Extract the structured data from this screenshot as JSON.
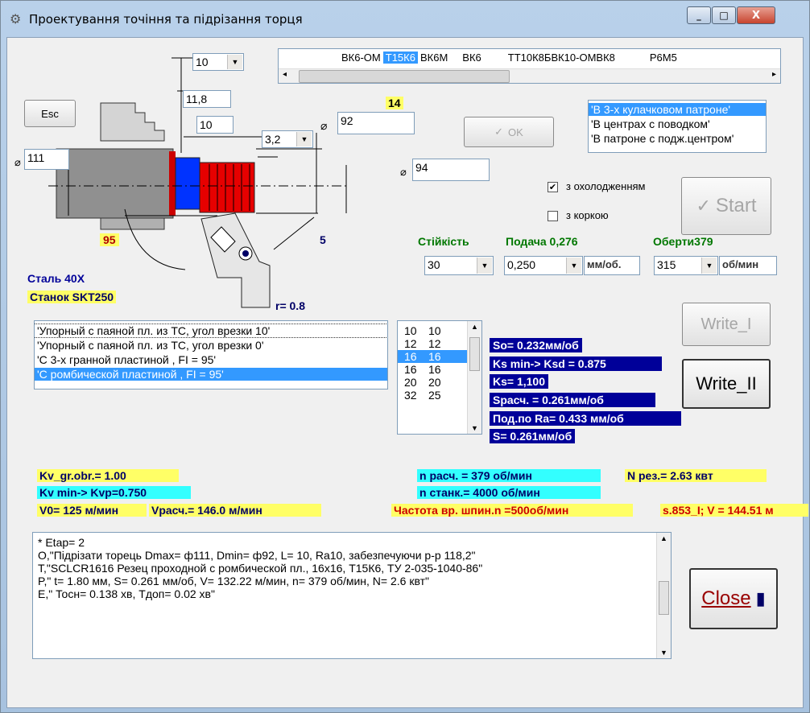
{
  "window": {
    "title": "Проектування точіння та підрізання торця",
    "minimize_label": "_",
    "maximize_label": "□",
    "close_label": "X"
  },
  "drawing": {
    "angle_combo": "10",
    "dim_118": "11,8",
    "dim_10": "10",
    "ra_combo": "3,2",
    "label_14": "14",
    "diam_92": "92",
    "diam_111": "111",
    "diam_94": "94",
    "angle_95": "95",
    "label_5": "5",
    "material": "Сталь  40Х",
    "machine": "Станок SKT250",
    "radius": "r=  0.8",
    "diam_symbol": "⌀"
  },
  "esc_button": "Esc",
  "ok_button": "OK",
  "start_button": "Start",
  "write1_button": "Write_I",
  "write2_button": "Write_II",
  "close_button": "Close",
  "materials_strip": {
    "items": [
      "ВК6-ОМ",
      "Т15К6",
      "ВК6М",
      "ВК6",
      "ТТ10К8БВК10-ОМВК8",
      "Р6М5"
    ],
    "selected": "Т15К6"
  },
  "fixture_list": {
    "items": [
      "'В 3-х кулачковом патроне'",
      "'В центрах  с  поводком'",
      "'В патроне с подж.центром'"
    ],
    "selected_index": 0
  },
  "cooling": {
    "label": "з охолодженням",
    "checked": true
  },
  "crust": {
    "label": "з коркою",
    "checked": false
  },
  "params": {
    "durability_label": "Стійкість",
    "durability_value": "30",
    "feed_label": "Подача 0,276",
    "feed_value": "0,250",
    "feed_unit": "мм/об.",
    "rpm_label": "Оберти379",
    "rpm_value": "315",
    "rpm_unit": "об/мин"
  },
  "tool_list": {
    "items": [
      "'Упорный с паяной пл. из ТС, угол врезки 10'",
      "'Упорный с паяной пл. из ТС, угол врезки 0'",
      "'С 3-х гранной пластиной ,  FI = 95'",
      "'С ромбической пластиной ,  FI = 95'"
    ],
    "selected_index": 3
  },
  "size_list": {
    "rows": [
      [
        "10",
        "10"
      ],
      [
        "12",
        "12"
      ],
      [
        "16",
        "16"
      ],
      [
        "16",
        "16"
      ],
      [
        "20",
        "20"
      ],
      [
        "32",
        "25"
      ]
    ],
    "selected_index": 2
  },
  "calc": {
    "so": "So= 0.232мм/об",
    "ks_min": "Ks min-> Ksd = 0.875",
    "ks": "Ks= 1,100",
    "s_calc": "Sрасч. = 0.261мм/об",
    "s_ra": "Под.по Ra= 0.433 мм/об",
    "s": "S= 0.261мм/об"
  },
  "results": {
    "kv_gr": "Kv_gr.obr.= 1.00",
    "kv_min": "Kv min-> Kvp=0.750",
    "v0": "V0= 125 м/мин",
    "v_calc": "Vрасч.= 146.0 м/мин",
    "n_calc": "n расч. =  379 об/мин",
    "n_st": "n станк.= 4000 об/мин",
    "freq": "Частота вр. шпин.n =500об/мин",
    "n_res": "N рез.= 2.63 квт",
    "s853": "s.853_I; V = 144.51 м"
  },
  "memo": {
    "lines": [
      "* Etap= 2",
      "O,\"Підрізати торець Dmax= ф111, Dmin= ф92, L= 10, Ra10, забезпечуючи р-р 118,2\"",
      "T,\"SCLCR1616 Резец проходной с ромбической пл., 16х16, Т15К6, ТУ 2-035-1040-86\"",
      "P,\" t= 1.80 мм, S= 0.261 мм/об, V= 132.22 м/мин, n=  379 об/мин, N= 2.6 квт\"",
      "E,\" Тосн= 0.138 хв, Тдоп= 0.02 хв\""
    ]
  },
  "colors": {
    "yellow": "#ffff66",
    "cyan": "#33ffff",
    "navy": "#000099",
    "selection": "#3399ff",
    "green_label": "#007700",
    "red_part": "#e00000"
  }
}
